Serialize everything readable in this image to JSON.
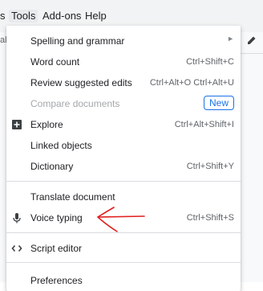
{
  "menubar": {
    "items": [
      {
        "label": "s"
      },
      {
        "label": "Tools"
      },
      {
        "label": "Add-ons"
      },
      {
        "label": "Help"
      }
    ]
  },
  "left_stub_text": "al",
  "tools_menu": {
    "spelling": {
      "label": "Spelling and grammar"
    },
    "word_count": {
      "label": "Word count",
      "shortcut": "Ctrl+Shift+C"
    },
    "review_edits": {
      "label": "Review suggested edits",
      "shortcut": "Ctrl+Alt+O Ctrl+Alt+U"
    },
    "compare": {
      "label": "Compare documents",
      "badge": "New"
    },
    "explore": {
      "label": "Explore",
      "shortcut": "Ctrl+Alt+Shift+I"
    },
    "linked": {
      "label": "Linked objects"
    },
    "dictionary": {
      "label": "Dictionary",
      "shortcut": "Ctrl+Shift+Y"
    },
    "translate": {
      "label": "Translate document"
    },
    "voice": {
      "label": "Voice typing",
      "shortcut": "Ctrl+Shift+S"
    },
    "script": {
      "label": "Script editor"
    },
    "preferences": {
      "label": "Preferences"
    }
  },
  "colors": {
    "accent": "#1a73e8",
    "annotation_arrow": "#e02020"
  }
}
